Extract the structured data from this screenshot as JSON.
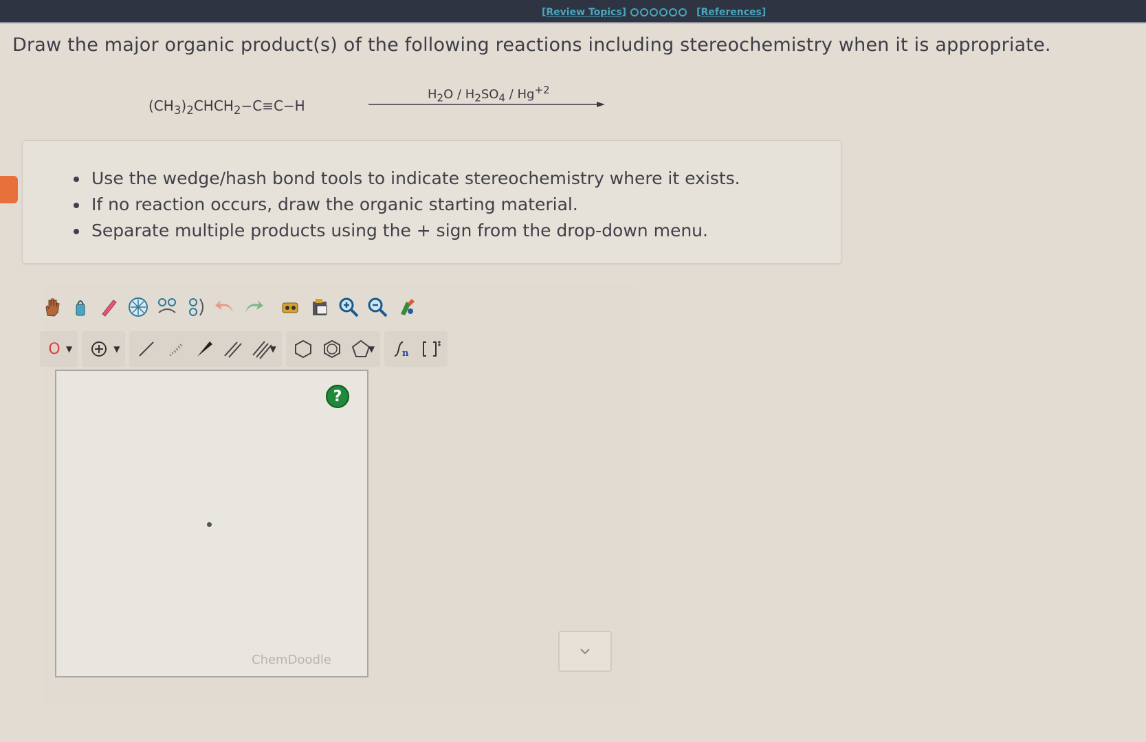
{
  "header": {
    "review_topics": "[Review Topics]",
    "references": "[References]"
  },
  "question": {
    "prompt": "Draw the major organic product(s) of the following reactions including stereochemistry when it is appropriate."
  },
  "reaction": {
    "reactant_parts": [
      "(CH",
      "3",
      ")",
      "2",
      "CHCH",
      "2",
      "−C≡C−H"
    ],
    "reagent_parts": [
      "H",
      "2",
      "O / H",
      "2",
      "SO",
      "4",
      " / Hg",
      "+2"
    ]
  },
  "instructions": {
    "items": [
      "Use the wedge/hash bond tools to indicate stereochemistry where it exists.",
      "If no reaction occurs, draw the organic starting material.",
      "Separate multiple products using the + sign from the drop-down menu."
    ]
  },
  "editor": {
    "element_label": "O",
    "help_label": "?",
    "watermark": "ChemDoodle",
    "tools_row1": [
      "hand-icon",
      "lasso-icon",
      "eraser-icon",
      "center-icon",
      "flip-horizontal-icon",
      "flip-vertical-icon",
      "undo-icon",
      "redo-icon",
      "copy-icon",
      "paste-icon",
      "zoom-in-icon",
      "zoom-out-icon",
      "clean-icon"
    ],
    "tools_row2": [
      "element-selector",
      "charge-plus-icon",
      "single-bond-icon",
      "hash-bond-icon",
      "wedge-bond-icon",
      "double-bond-icon",
      "triple-bond-icon",
      "benzene-icon",
      "cyclohexane-icon",
      "cyclopentane-icon",
      "repeat-unit-icon",
      "bracket-icon"
    ]
  },
  "colors": {
    "background": "#e3dcd2",
    "topbar": "#2e3442",
    "link": "#4aa6bf",
    "help_button": "#1f8a3a",
    "side_tab": "#e8703a"
  }
}
